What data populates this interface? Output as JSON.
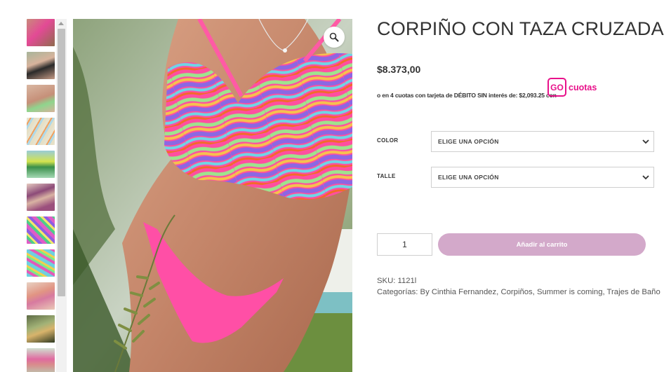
{
  "product": {
    "title": "CORPIÑO CON TAZA CRUZADA",
    "price": "$8.373,00",
    "installments_text": "o en 4 cuotas con tarjeta de DÉBITO SIN interés de: $2,093.25 con",
    "gocuotas_logo_mark": "GO",
    "gocuotas_logo_text": "cuotas",
    "brand_color": "#e8118a",
    "image_alt": "Bikini estampado con ondas de colores"
  },
  "variations": [
    {
      "label": "COLOR",
      "selected": "ELIGE UNA OPCIÓN"
    },
    {
      "label": "TALLE",
      "selected": "ELIGE UNA OPCIÓN"
    }
  ],
  "cart": {
    "quantity": "1",
    "add_label": "Añadir al carrito",
    "button_color": "#d3a9ca"
  },
  "meta": {
    "sku_label": "SKU:",
    "sku": "1121l",
    "categories_label": "Categorías:",
    "categories": "By Cinthia Fernandez, Corpiños, Summer is coming, Trajes de Baño"
  },
  "gallery": {
    "thumbnail_count": 11,
    "zoom_icon": "magnifier-icon"
  }
}
